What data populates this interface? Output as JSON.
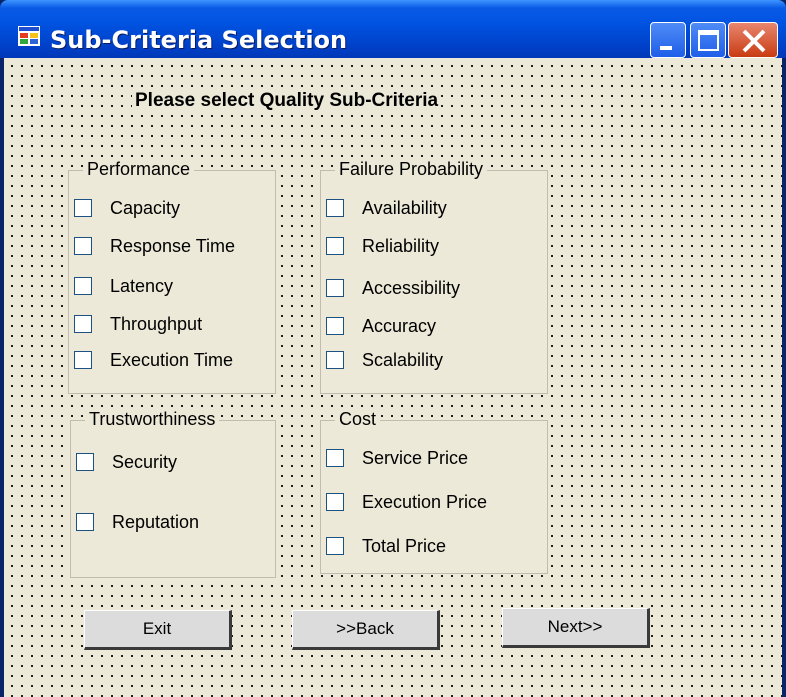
{
  "window": {
    "title": "Sub-Criteria Selection"
  },
  "heading": "Please select Quality Sub-Criteria",
  "groups": {
    "performance": {
      "title": "Performance",
      "items": [
        "Capacity",
        "Response Time",
        "Latency",
        "Throughput",
        "Execution Time"
      ]
    },
    "failure": {
      "title": "Failure Probability",
      "items": [
        "Availability",
        "Reliability",
        "Accessibility",
        "Accuracy",
        "Scalability"
      ]
    },
    "trust": {
      "title": "Trustworthiness",
      "items": [
        "Security",
        "Reputation"
      ]
    },
    "cost": {
      "title": "Cost",
      "items": [
        "Service Price",
        "Execution Price",
        "Total Price"
      ]
    }
  },
  "buttons": {
    "exit": "Exit",
    "back": ">>Back",
    "next": "Next>>"
  },
  "checked": false,
  "colors": {
    "titlebar": "#0053e1",
    "client": "#ece9d8",
    "close": "#c93b12"
  }
}
